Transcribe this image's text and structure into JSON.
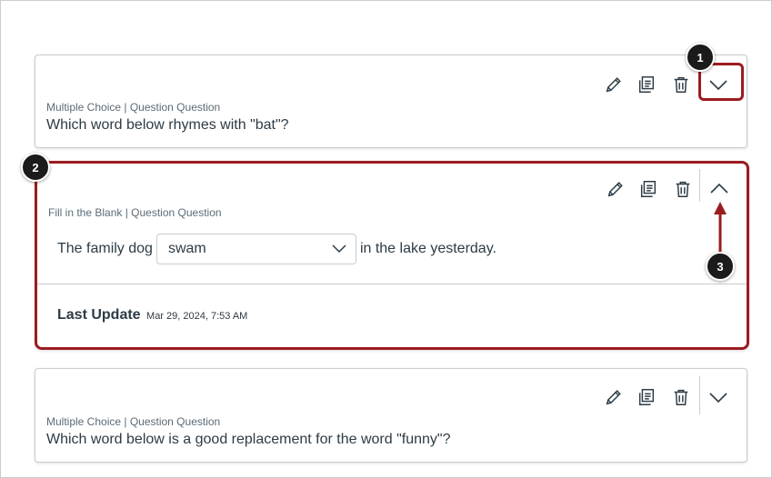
{
  "questions": [
    {
      "meta": "Multiple Choice | Question Question",
      "text": "Which word below rhymes with \"bat\"?"
    },
    {
      "meta": "Fill in the Blank | Question Question",
      "prefix": "The family dog",
      "selected": "swam",
      "suffix": "in the lake yesterday.",
      "last_update_label": "Last Update",
      "last_update_date": "Mar 29, 2024, 7:53 AM"
    },
    {
      "meta": "Multiple Choice | Question Question",
      "text": "Which word below is a good replacement for the word \"funny\"?"
    }
  ],
  "callouts": [
    "1",
    "2",
    "3"
  ],
  "icons": [
    "edit-icon",
    "copy-icon",
    "trash-icon",
    "chevron-down-icon",
    "chevron-up-icon"
  ],
  "colors": {
    "highlight": "#9b1c1f",
    "text": "#2d3b45",
    "muted": "#5b6b77",
    "border": "#c7cdd1"
  }
}
